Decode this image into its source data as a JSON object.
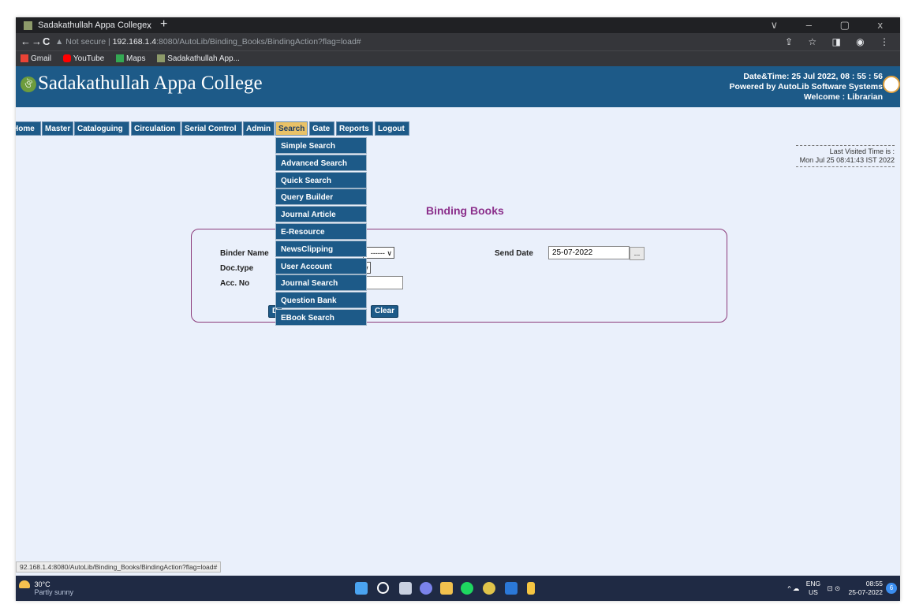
{
  "browser": {
    "tab_title": "Sadakathullah Appa College",
    "tab_close": "x",
    "new_tab": "+",
    "window_controls": "∨  –  ▢  x",
    "nav_back": "←",
    "nav_forward": "→",
    "nav_reload": "C",
    "security_label": "▲ Not secure",
    "url_host": "192.168.1.4",
    "url_rest": ":8080/AutoLib/Binding_Books/BindingAction?flag=load#",
    "toolbar_right": "⇪ ☆ ◨ ◉ ⋮",
    "bookmarks": [
      {
        "label": "Gmail",
        "color": "#ea4335"
      },
      {
        "label": "YouTube",
        "color": "#ff0000"
      },
      {
        "label": "Maps",
        "color": "#34a853"
      },
      {
        "label": "Sadakathullah App...",
        "color": "#8d9a6a"
      }
    ],
    "status_url": "92.168.1.4:8080/AutoLib/Binding_Books/BindingAction?flag=load#"
  },
  "header": {
    "logo_glyph": "ঔ",
    "title": "Sadakathullah Appa College",
    "datetime": "Date&Time:  25 Jul 2022, 08 : 55 : 56",
    "powered_by": "Powered by AutoLib Software Systems",
    "welcome": "Welcome  :  Librarian"
  },
  "menu": {
    "items": [
      {
        "label": "Home"
      },
      {
        "label": "Master"
      },
      {
        "label": "Cataloguing"
      },
      {
        "label": "Circulation"
      },
      {
        "label": "Serial Control"
      },
      {
        "label": "Admin"
      },
      {
        "label": "Search",
        "active": true
      },
      {
        "label": "Gate"
      },
      {
        "label": "Reports"
      },
      {
        "label": "Logout"
      }
    ]
  },
  "search_dropdown": {
    "items": [
      "Simple Search",
      "Advanced Search",
      "Quick Search",
      "Query Builder",
      "Journal Article",
      "E-Resource",
      "NewsClipping",
      "User Account",
      "Journal Search",
      "Question Bank",
      "EBook Search"
    ]
  },
  "last_visited": {
    "label": "Last Visited Time is :",
    "value": "Mon Jul 25 08:41:43 IST 2022"
  },
  "form": {
    "title": "Binding Books",
    "binder_name_label": "Binder Name",
    "binder_select_text": "------ ∨",
    "doctype_label": "Doc.type",
    "doctype_select_text": "∨",
    "accno_label": "Acc. No",
    "accno_value": "",
    "send_date_label": "Send Date",
    "send_date_value": "25-07-2022",
    "date_picker_label": "...",
    "first_button_partial": "D",
    "clear_button": "Clear"
  },
  "taskbar": {
    "temperature": "30°C",
    "weather": "Partly sunny",
    "tray_icons": "^ ☁",
    "language_top": "ENG",
    "language_bottom": "US",
    "tray_sys": "⊡ ⊙",
    "time": "08:55",
    "date": "25-07-2022",
    "notification": "6",
    "icons": [
      {
        "name": "windows-start-icon",
        "color": "#4aa3f0"
      },
      {
        "name": "search-icon",
        "color": "#ffffff"
      },
      {
        "name": "task-view-icon",
        "color": "#c8d0e0"
      },
      {
        "name": "chat-icon",
        "color": "#7b83eb"
      },
      {
        "name": "file-explorer-icon",
        "color": "#f2c14e"
      },
      {
        "name": "spotify-icon",
        "color": "#1ed760"
      },
      {
        "name": "chrome-icon",
        "color": "#e0c34a"
      },
      {
        "name": "word-icon",
        "color": "#2b78d8"
      },
      {
        "name": "app-icon",
        "color": "#f5c542"
      }
    ]
  }
}
